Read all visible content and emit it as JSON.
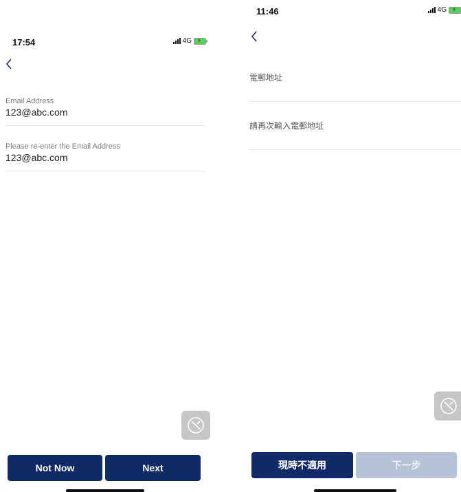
{
  "left": {
    "status": {
      "time": "17:54",
      "network": "4G"
    },
    "fields": [
      {
        "label": "Email Address",
        "value": "123@abc.com"
      },
      {
        "label": "Please re-enter the Email Address",
        "value": "123@abc.com"
      }
    ],
    "buttons": {
      "secondary": "Not Now",
      "primary": "Next"
    }
  },
  "right": {
    "status": {
      "time": "11:46",
      "network": "4G"
    },
    "fields": [
      {
        "label": "電郵地址",
        "value": ""
      },
      {
        "label": "請再次輸入電郵地址",
        "value": ""
      }
    ],
    "buttons": {
      "secondary": "現時不適用",
      "primary": "下一步"
    }
  },
  "icons": {
    "back": "chevron-left-icon",
    "assist": "wrench-screwdriver-icon"
  },
  "colors": {
    "primary": "#0f2a67",
    "disabled": "#b7c2d9"
  }
}
